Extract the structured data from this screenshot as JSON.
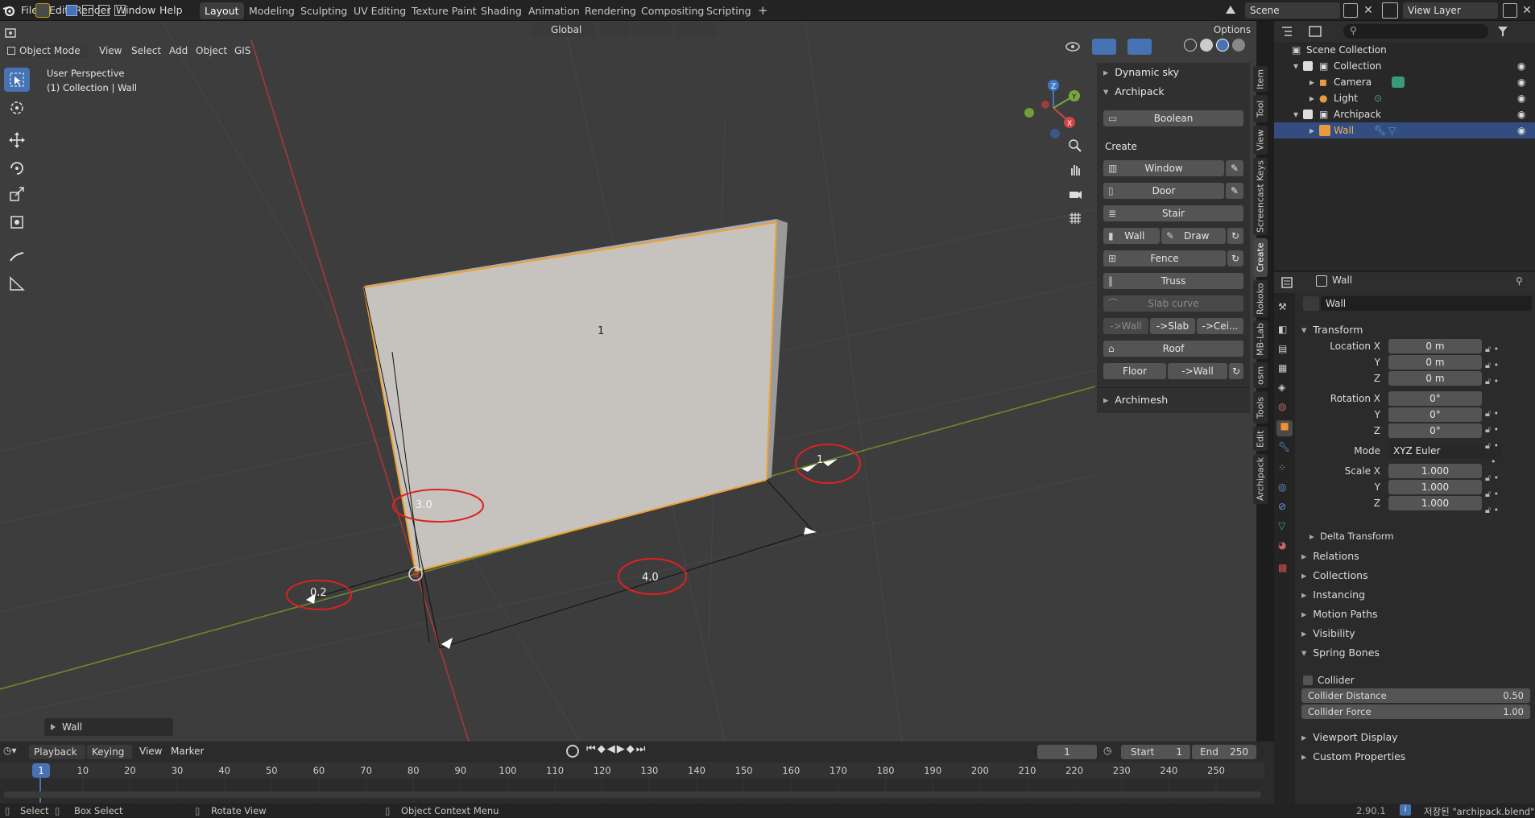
{
  "topbar": {
    "menus": [
      "File",
      "Edit",
      "Render",
      "Window",
      "Help"
    ],
    "workspaces": [
      "Layout",
      "Modeling",
      "Sculpting",
      "UV Editing",
      "Texture Paint",
      "Shading",
      "Animation",
      "Rendering",
      "Compositing",
      "Scripting"
    ],
    "active_workspace": "Layout",
    "add_workspace": "+",
    "scene": "Scene",
    "view_layer": "View Layer"
  },
  "viewport_header": {
    "mode": "Object Mode",
    "menus": [
      "View",
      "Select",
      "Add",
      "Object",
      "GIS"
    ],
    "orientation": "Global",
    "options": "Options"
  },
  "viewport": {
    "perspective": "User Perspective",
    "collection_info": "(1) Collection | Wall",
    "dimension_labels": {
      "height": "3.0",
      "length": "4.0",
      "thickness": "0.2",
      "side": "1",
      "face": "1"
    },
    "gizmo_axes": {
      "x": "X",
      "y": "Y",
      "z": "Z"
    },
    "last_op": "Wall"
  },
  "npanel": {
    "dynamic_sky": "Dynamic sky",
    "archipack": "Archipack",
    "boolean": "Boolean",
    "create": "Create",
    "window": "Window",
    "door": "Door",
    "stair": "Stair",
    "wall": "Wall",
    "draw": "Draw",
    "fence": "Fence",
    "truss": "Truss",
    "slab_curve": "Slab curve",
    "to_wall": "->Wall",
    "to_slab": "->Slab",
    "to_ceil": "->Cei...",
    "roof": "Roof",
    "floor": "Floor",
    "floor_to_wall": "->Wall",
    "archimesh": "Archimesh"
  },
  "side_tabs": [
    "Item",
    "Tool",
    "View",
    "Screencast Keys",
    "Create",
    "Rokoko",
    "MB-Lab",
    "osm",
    "Tools",
    "Edit",
    "Archipack"
  ],
  "outliner": {
    "scene_collection": "Scene Collection",
    "collection": "Collection",
    "camera": "Camera",
    "light": "Light",
    "archipack": "Archipack",
    "wall": "Wall"
  },
  "properties": {
    "object_name": "Wall",
    "object_field": "Wall",
    "transform": "Transform",
    "location_x_label": "Location X",
    "location_x": "0 m",
    "y_label": "Y",
    "location_y": "0 m",
    "z_label": "Z",
    "location_z": "0 m",
    "rotation_x_label": "Rotation X",
    "rotation_x": "0°",
    "rotation_y": "0°",
    "rotation_z": "0°",
    "mode_label": "Mode",
    "mode_value": "XYZ Euler",
    "scale_x_label": "Scale X",
    "scale_x": "1.000",
    "scale_y": "1.000",
    "scale_z": "1.000",
    "delta_transform": "Delta Transform",
    "relations": "Relations",
    "collections": "Collections",
    "instancing": "Instancing",
    "motion_paths": "Motion Paths",
    "visibility": "Visibility",
    "spring_bones": "Spring Bones",
    "collider": "Collider",
    "collider_distance_label": "Collider Distance",
    "collider_distance": "0.50",
    "collider_force_label": "Collider Force",
    "collider_force": "1.00",
    "viewport_display": "Viewport Display",
    "custom_properties": "Custom Properties"
  },
  "timeline": {
    "menus": [
      "Playback",
      "Keying",
      "View",
      "Marker"
    ],
    "current_frame": "1",
    "start_label": "Start",
    "start": "1",
    "end_label": "End",
    "end": "250",
    "ticks": [
      "1",
      "10",
      "20",
      "30",
      "40",
      "50",
      "60",
      "70",
      "80",
      "90",
      "100",
      "110",
      "120",
      "130",
      "140",
      "150",
      "160",
      "170",
      "180",
      "190",
      "200",
      "210",
      "220",
      "230",
      "240",
      "250"
    ],
    "frame_indicator": "1"
  },
  "statusbar": {
    "select": "Select",
    "box_select": "Box Select",
    "rotate_view": "Rotate View",
    "context_menu": "Object Context Menu",
    "version": "2.90.1",
    "saved": "저장된 \"archipack.blend\""
  },
  "colors": {
    "accent": "#4772b3",
    "orange_outline": "#f0a030",
    "annotation_red": "#e02020",
    "x_axis": "#c0392b",
    "y_axis": "#7ea040"
  }
}
